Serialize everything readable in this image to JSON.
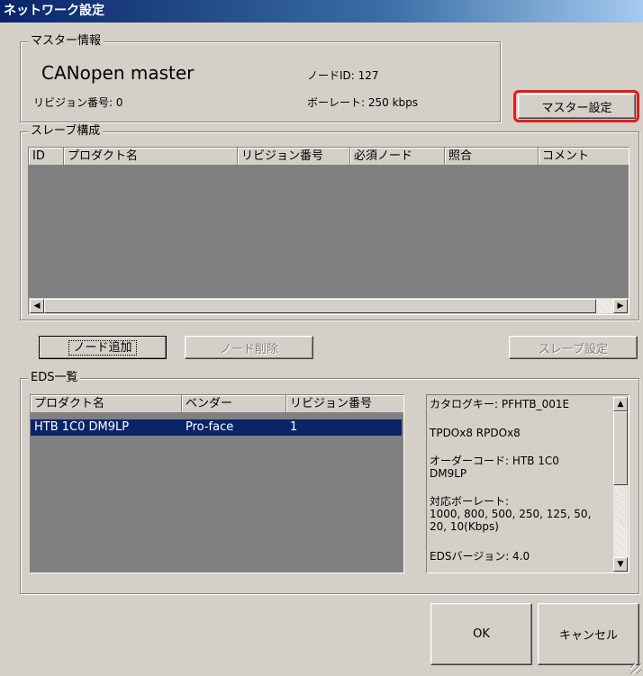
{
  "window": {
    "title": "ネットワーク設定"
  },
  "master": {
    "group_title": "マスター情報",
    "name": "CANopen master",
    "revision": "リビジョン番号: 0",
    "node_id": "ノードID: 127",
    "baud_rate": "ボーレート: 250 kbps",
    "settings_button": "マスター設定"
  },
  "slaves": {
    "group_title": "スレーブ構成",
    "columns": [
      "ID",
      "プロダクト名",
      "リビジョン番号",
      "必須ノード",
      "照合",
      "コメント"
    ]
  },
  "buttons": {
    "add_node": "ノード追加",
    "delete_node": "ノード削除",
    "slave_settings": "スレーブ設定",
    "ok": "OK",
    "cancel": "キャンセル"
  },
  "eds": {
    "group_title": "EDS一覧",
    "columns": [
      "プロダクト名",
      "ベンダー",
      "リビジョン番号"
    ],
    "rows": [
      {
        "product": "HTB 1C0 DM9LP",
        "vendor": "Pro-face",
        "revision": "1"
      }
    ],
    "details": {
      "catalog_key": "カタログキー: PFHTB_001E",
      "pdo": "TPDOx8 RPDOx8",
      "order_code_1": "オーダーコード: HTB 1C0",
      "order_code_2": "DM9LP",
      "baud_title": "対応ボーレート:",
      "baud_line1": "1000, 800, 500, 250, 125, 50,",
      "baud_line2": "20, 10(Kbps)",
      "eds_version": "EDSバージョン: 4.0"
    }
  },
  "colors": {
    "highlight": "#e51b1b",
    "selection": "#0a246a",
    "list_bg": "#808080"
  }
}
